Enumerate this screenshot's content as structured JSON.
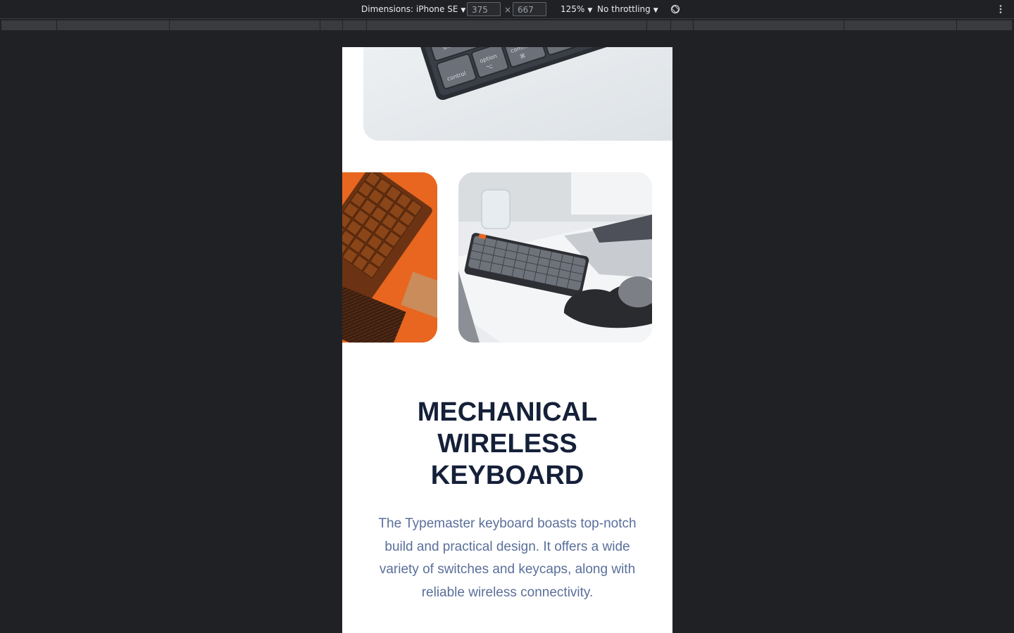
{
  "toolbar": {
    "dimensions_label": "Dimensions: iPhone SE",
    "width_value": "375",
    "height_value": "667",
    "times": "×",
    "zoom": "125%",
    "throttling": "No throttling",
    "caret": "▼"
  },
  "product": {
    "headline_lines": [
      "MECHANICAL",
      "WIRELESS",
      "KEYBOARD"
    ],
    "description": "The Typemaster keyboard boasts top-notch build and practical design. It offers a wide variety of switches and keycaps, along with reliable wireless connectivity.",
    "hero_keys": [
      "shift",
      "option",
      "command",
      "control",
      "⌥",
      "⌘"
    ]
  },
  "colors": {
    "headline": "#152039",
    "description": "#5a6f9a",
    "accent_orange": "#e8661f",
    "devtools_bg": "#202124"
  }
}
